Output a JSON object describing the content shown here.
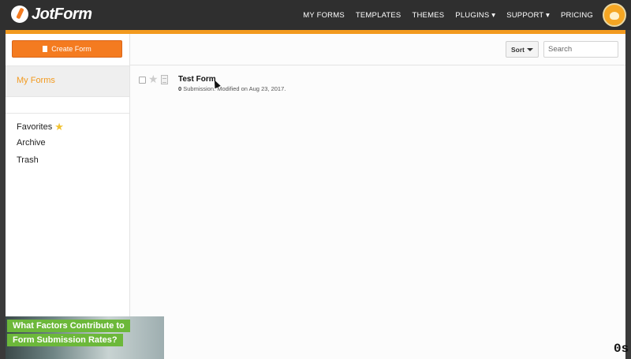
{
  "topbar": {
    "logo_text": "JotForm",
    "nav": [
      {
        "label": "MY FORMS"
      },
      {
        "label": "TEMPLATES"
      },
      {
        "label": "THEMES"
      },
      {
        "label": "PLUGINS ▾"
      },
      {
        "label": "SUPPORT ▾"
      },
      {
        "label": "PRICING"
      }
    ],
    "avatar_icon": "user-avatar-icon"
  },
  "sidebar": {
    "create_button": "Create Form",
    "current": "My Forms",
    "links": [
      {
        "label": "Favorites",
        "icon": "star-icon"
      },
      {
        "label": "Archive"
      },
      {
        "label": "Trash"
      }
    ]
  },
  "toolbar": {
    "sort_label": "Sort",
    "search_placeholder": "Search"
  },
  "forms": [
    {
      "title": "Test Form",
      "submissions": "0",
      "meta": " Submission. Modified on Aug 23, 2017."
    }
  ],
  "promo": {
    "line1": "What Factors Contribute to",
    "line2": "Form Submission Rates?"
  },
  "corner_text": "0s",
  "colors": {
    "brand_orange": "#f47b20",
    "accent_orange": "#f29a1f",
    "topbar": "#2f2f2f",
    "promo_green": "#6cb83a"
  }
}
